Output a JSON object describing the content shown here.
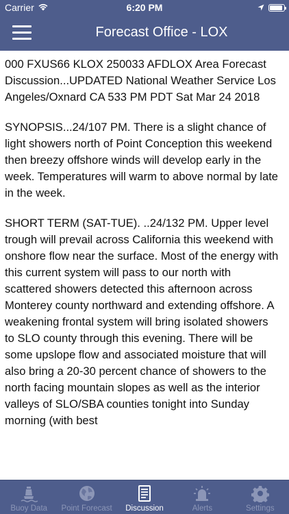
{
  "status_bar": {
    "carrier": "Carrier",
    "time": "6:20 PM",
    "battery_level": 0.9
  },
  "nav": {
    "title": "Forecast Office - LOX"
  },
  "discussion": {
    "header": "000 FXUS66 KLOX 250033 AFDLOX  Area Forecast Discussion...UPDATED National Weather Service Los Angeles/Oxnard CA 533 PM PDT Sat Mar 24 2018",
    "synopsis": "SYNOPSIS...24/107 PM.  There is a slight chance of light showers north of Point Conception this weekend then breezy offshore winds will develop early in the week. Temperatures will warm to above normal by late in the week.",
    "short_term": "SHORT TERM (SAT-TUE). ..24/132 PM.  Upper level trough will prevail across California this weekend with onshore flow near the surface. Most of the energy with this current system will pass to our north with scattered showers detected this afternoon across Monterey county northward and extending offshore. A weakening frontal system will bring isolated showers to SLO county through this evening. There will be some upslope flow and associated moisture that will also bring a 20-30 percent chance of showers to the north facing mountain slopes as well as the interior valleys of SLO/SBA counties tonight into Sunday morning (with best"
  },
  "tabs": [
    {
      "label": "Buoy Data",
      "icon": "buoy-icon",
      "active": false
    },
    {
      "label": "Point Forecast",
      "icon": "globe-icon",
      "active": false
    },
    {
      "label": "Discussion",
      "icon": "document-icon",
      "active": true
    },
    {
      "label": "Alerts",
      "icon": "alarm-bell-icon",
      "active": false
    },
    {
      "label": "Settings",
      "icon": "gear-icon",
      "active": false
    }
  ],
  "colors": {
    "bar_background": "#4e5d8c",
    "tab_inactive": "#8c96b7",
    "tab_active": "#ffffff"
  }
}
